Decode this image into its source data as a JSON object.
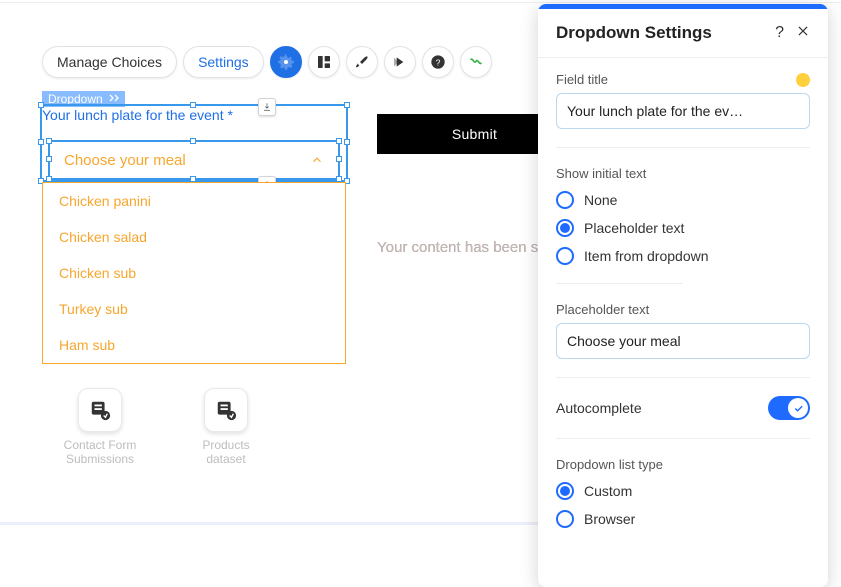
{
  "toolbar": {
    "manage_choices": "Manage Choices",
    "settings": "Settings"
  },
  "canvas": {
    "element_tag": "Dropdown",
    "field_label": "Your lunch plate for the event *",
    "placeholder": "Choose your meal",
    "options": [
      "Chicken panini",
      "Chicken salad",
      "Chicken sub",
      "Turkey sub",
      "Ham sub"
    ],
    "submit": "Submit",
    "msg_error": "Your content has been submitted.",
    "msg_success": "Your content has been submitted",
    "dataset1_l1": "Contact Form",
    "dataset1_l2": "Submissions",
    "dataset2_l1": "Products",
    "dataset2_l2": "dataset"
  },
  "panel": {
    "title": "Dropdown Settings",
    "field_title_label": "Field title",
    "field_title_value": "Your lunch plate for the ev…",
    "show_initial_label": "Show initial text",
    "radio_none": "None",
    "radio_placeholder": "Placeholder text",
    "radio_item": "Item from dropdown",
    "placeholder_label": "Placeholder text",
    "placeholder_value": "Choose your meal",
    "autocomplete_label": "Autocomplete",
    "list_type_label": "Dropdown list type",
    "radio_custom": "Custom",
    "radio_browser": "Browser"
  }
}
